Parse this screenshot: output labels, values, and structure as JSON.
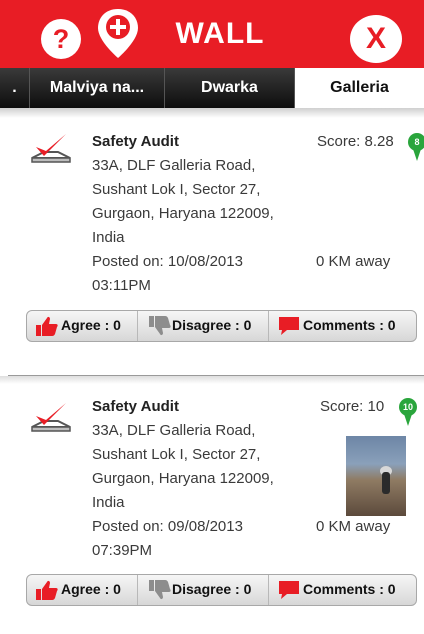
{
  "header": {
    "title": "WALL",
    "help_label": "?",
    "close_label": "X",
    "brand_color": "#e81d25",
    "icons": [
      "question-icon",
      "add-location-pin-icon",
      "close-icon"
    ]
  },
  "tabs": [
    {
      "label": "."
    },
    {
      "label": "Malviya na..."
    },
    {
      "label": "Dwarka"
    },
    {
      "label": "Galleria",
      "active": true
    }
  ],
  "posts": [
    {
      "title": "Safety Audit",
      "address": [
        "33A, DLF Galleria Road,",
        "Sushant Lok I, Sector 27,",
        "Gurgaon, Haryana 122009,",
        "India"
      ],
      "posted": [
        "Posted on: 10/08/2013",
        "03:11PM"
      ],
      "score": "Score: 8.28",
      "score_badge": "8",
      "distance": "0 KM away",
      "agree": "Agree : 0",
      "disagree": "Disagree : 0",
      "comments": "Comments : 0",
      "has_photo": false
    },
    {
      "title": "Safety Audit",
      "address": [
        "33A, DLF Galleria Road,",
        "Sushant Lok I, Sector 27,",
        "Gurgaon, Haryana 122009,",
        "India"
      ],
      "posted": [
        "Posted on: 09/08/2013",
        "07:39PM"
      ],
      "score": "Score: 10",
      "score_badge": "10",
      "distance": "0 KM away",
      "agree": "Agree : 0",
      "disagree": "Disagree : 0",
      "comments": "Comments : 0",
      "has_photo": true
    }
  ],
  "colors": {
    "accent_red": "#e81d25",
    "pin_green": "#2aa53c",
    "disagree_gray": "#8d8d8d"
  }
}
